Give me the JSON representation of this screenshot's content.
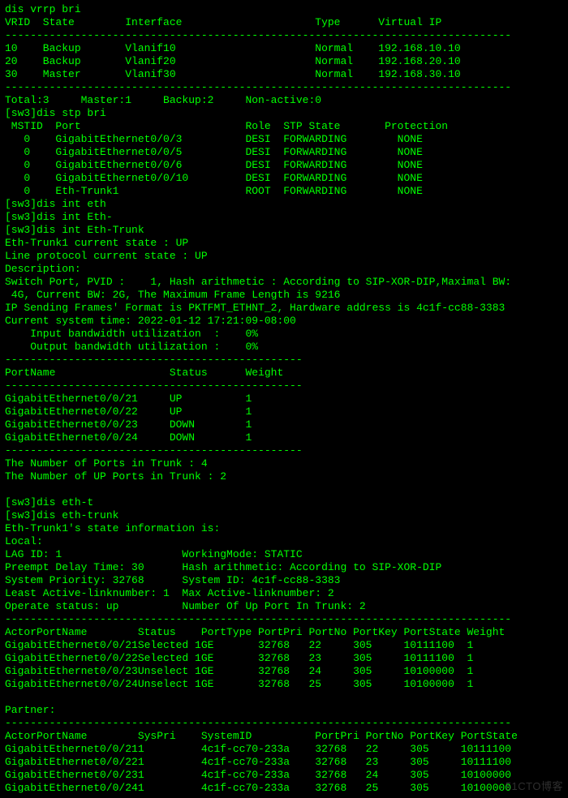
{
  "cmd_vrrp": "dis vrrp bri",
  "vrrp_hdr": {
    "vrid": "VRID",
    "state": "State",
    "iface": "Interface",
    "type": "Type",
    "vip": "Virtual IP"
  },
  "vrrp": [
    {
      "vrid": "10",
      "state": "Backup",
      "iface": "Vlanif10",
      "type": "Normal",
      "vip": "192.168.10.10"
    },
    {
      "vrid": "20",
      "state": "Backup",
      "iface": "Vlanif20",
      "type": "Normal",
      "vip": "192.168.20.10"
    },
    {
      "vrid": "30",
      "state": "Master",
      "iface": "Vlanif30",
      "type": "Normal",
      "vip": "192.168.30.10"
    }
  ],
  "vrrp_totals": "Total:3     Master:1     Backup:2     Non-active:0",
  "cmd_stp": "[sw3]dis stp bri",
  "stp_hdr": {
    "mstid": " MSTID",
    "port": "Port",
    "role": "Role",
    "state": "STP State",
    "prot": "Protection"
  },
  "stp": [
    {
      "mstid": "0",
      "port": "GigabitEthernet0/0/3",
      "role": "DESI",
      "state": "FORWARDING",
      "prot": "NONE"
    },
    {
      "mstid": "0",
      "port": "GigabitEthernet0/0/5",
      "role": "DESI",
      "state": "FORWARDING",
      "prot": "NONE"
    },
    {
      "mstid": "0",
      "port": "GigabitEthernet0/0/6",
      "role": "DESI",
      "state": "FORWARDING",
      "prot": "NONE"
    },
    {
      "mstid": "0",
      "port": "GigabitEthernet0/0/10",
      "role": "DESI",
      "state": "FORWARDING",
      "prot": "NONE"
    },
    {
      "mstid": "0",
      "port": "Eth-Trunk1",
      "role": "ROOT",
      "state": "FORWARDING",
      "prot": "NONE"
    }
  ],
  "cmds_int": [
    "[sw3]dis int eth",
    "[sw3]dis int Eth-",
    "[sw3]dis int Eth-Trunk"
  ],
  "trunk_state": "Eth-Trunk1 current state : UP",
  "proto_state": "Line protocol current state : UP",
  "desc": "Description:",
  "switchport1": "Switch Port, PVID :    1, Hash arithmetic : According to SIP-XOR-DIP,Maximal BW:",
  "switchport2": " 4G, Current BW: 2G, The Maximum Frame Length is 9216",
  "ip_frames": "IP Sending Frames' Format is PKTFMT_ETHNT_2, Hardware address is 4c1f-cc88-3383",
  "systime": "Current system time: 2022-01-12 17:21:09-08:00",
  "bw_in": "    Input bandwidth utilization  :    0%",
  "bw_out": "    Output bandwidth utilization :    0%",
  "mem_hdr": {
    "name": "PortName",
    "status": "Status",
    "weight": "Weight"
  },
  "members": [
    {
      "name": "GigabitEthernet0/0/21",
      "status": "UP",
      "weight": "1"
    },
    {
      "name": "GigabitEthernet0/0/22",
      "status": "UP",
      "weight": "1"
    },
    {
      "name": "GigabitEthernet0/0/23",
      "status": "DOWN",
      "weight": "1"
    },
    {
      "name": "GigabitEthernet0/0/24",
      "status": "DOWN",
      "weight": "1"
    }
  ],
  "num_ports": "The Number of Ports in Trunk : 4",
  "num_up": "The Number of UP Ports in Trunk : 2",
  "cmds_ethtrunk": [
    "[sw3]dis eth-t",
    "[sw3]dis eth-trunk"
  ],
  "trunk_info": "Eth-Trunk1's state information is:",
  "local_label": "Local:",
  "lag_line": "LAG ID: 1                   WorkingMode: STATIC",
  "preempt": "Preempt Delay Time: 30      Hash arithmetic: According to SIP-XOR-DIP",
  "syspri": "System Priority: 32768      System ID: 4c1f-cc88-3383",
  "activelink": "Least Active-linknumber: 1  Max Active-linknumber: 2",
  "operate": "Operate status: up          Number Of Up Port In Trunk: 2",
  "actor_hdr": {
    "name": "ActorPortName",
    "status": "Status",
    "ptype": "PortType",
    "ppri": "PortPri",
    "pno": "PortNo",
    "pkey": "PortKey",
    "pstate": "PortState",
    "weight": "Weight"
  },
  "actors": [
    {
      "name": "GigabitEthernet0/0/21",
      "status": "Selected",
      "ptype": "1GE",
      "ppri": "32768",
      "pno": "22",
      "pkey": "305",
      "pstate": "10111100",
      "weight": "1"
    },
    {
      "name": "GigabitEthernet0/0/22",
      "status": "Selected",
      "ptype": "1GE",
      "ppri": "32768",
      "pno": "23",
      "pkey": "305",
      "pstate": "10111100",
      "weight": "1"
    },
    {
      "name": "GigabitEthernet0/0/23",
      "status": "Unselect",
      "ptype": "1GE",
      "ppri": "32768",
      "pno": "24",
      "pkey": "305",
      "pstate": "10100000",
      "weight": "1"
    },
    {
      "name": "GigabitEthernet0/0/24",
      "status": "Unselect",
      "ptype": "1GE",
      "ppri": "32768",
      "pno": "25",
      "pkey": "305",
      "pstate": "10100000",
      "weight": "1"
    }
  ],
  "partner_label": "Partner:",
  "partner_hdr": {
    "name": "ActorPortName",
    "syspri": "SysPri",
    "sysid": "SystemID",
    "ppri": "PortPri",
    "pno": "PortNo",
    "pkey": "PortKey",
    "pstate": "PortState"
  },
  "partners": [
    {
      "name": "GigabitEthernet0/0/21",
      "syspri": "1",
      "sysid": "4c1f-cc70-233a",
      "ppri": "32768",
      "pno": "22",
      "pkey": "305",
      "pstate": "10111100"
    },
    {
      "name": "GigabitEthernet0/0/22",
      "syspri": "1",
      "sysid": "4c1f-cc70-233a",
      "ppri": "32768",
      "pno": "23",
      "pkey": "305",
      "pstate": "10111100"
    },
    {
      "name": "GigabitEthernet0/0/23",
      "syspri": "1",
      "sysid": "4c1f-cc70-233a",
      "ppri": "32768",
      "pno": "24",
      "pkey": "305",
      "pstate": "10100000"
    },
    {
      "name": "GigabitEthernet0/0/24",
      "syspri": "1",
      "sysid": "4c1f-cc70-233a",
      "ppri": "32768",
      "pno": "25",
      "pkey": "305",
      "pstate": "10100000"
    }
  ],
  "watermark": "51CTO博客",
  "dash80": "--------------------------------------------------------------------------------",
  "dash47": "-----------------------------------------------"
}
